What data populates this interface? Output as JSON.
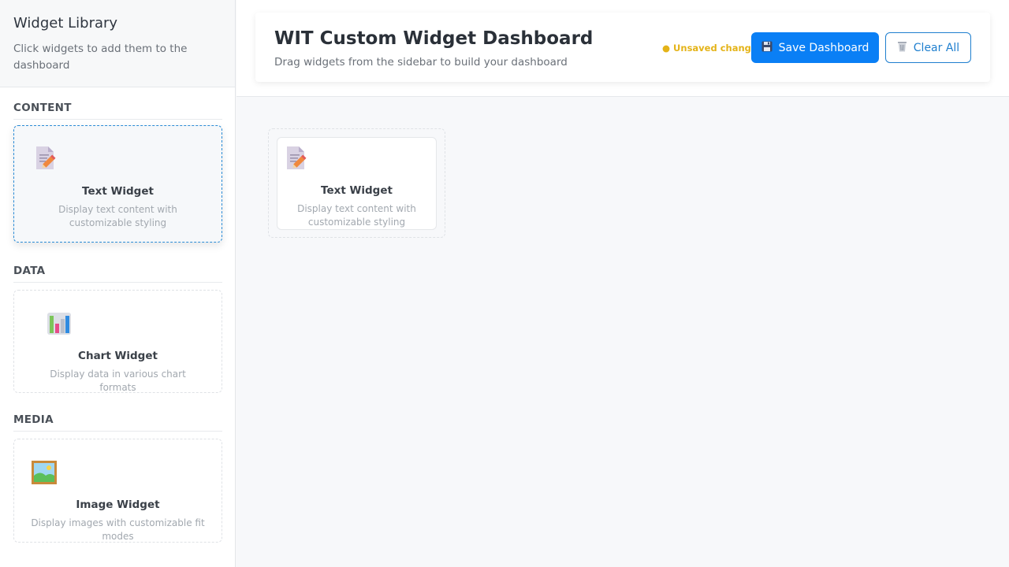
{
  "sidebar": {
    "title": "Widget Library",
    "subtitle": "Click widgets to add them to the dashboard",
    "sections": [
      {
        "label": "CONTENT",
        "widgets": [
          {
            "name": "Text Widget",
            "description": "Display text content with customizable styling",
            "icon": "document-pencil-icon"
          }
        ]
      },
      {
        "label": "DATA",
        "widgets": [
          {
            "name": "Chart Widget",
            "description": "Display data in various chart formats",
            "icon": "bar-chart-icon"
          }
        ]
      },
      {
        "label": "MEDIA",
        "widgets": [
          {
            "name": "Image Widget",
            "description": "Display images with customizable fit modes",
            "icon": "framed-picture-icon"
          }
        ]
      }
    ]
  },
  "header": {
    "title": "WIT Custom Widget Dashboard",
    "subtitle": "Drag widgets from the sidebar to build your dashboard",
    "unsaved_label": "● Unsaved changes",
    "save_label": "Save Dashboard",
    "save_icon": "floppy-disk-icon",
    "clear_label": "Clear All",
    "clear_icon": "wastebasket-icon"
  },
  "canvas": {
    "widgets": [
      {
        "name": "Text Widget",
        "description": "Display text content with customizable styling",
        "icon": "document-pencil-icon"
      }
    ]
  },
  "colors": {
    "accent": "#0a7ff5",
    "outline_accent": "#1f7fcf",
    "unsaved": "#e4b318",
    "selected_border": "#2a8bd6"
  }
}
